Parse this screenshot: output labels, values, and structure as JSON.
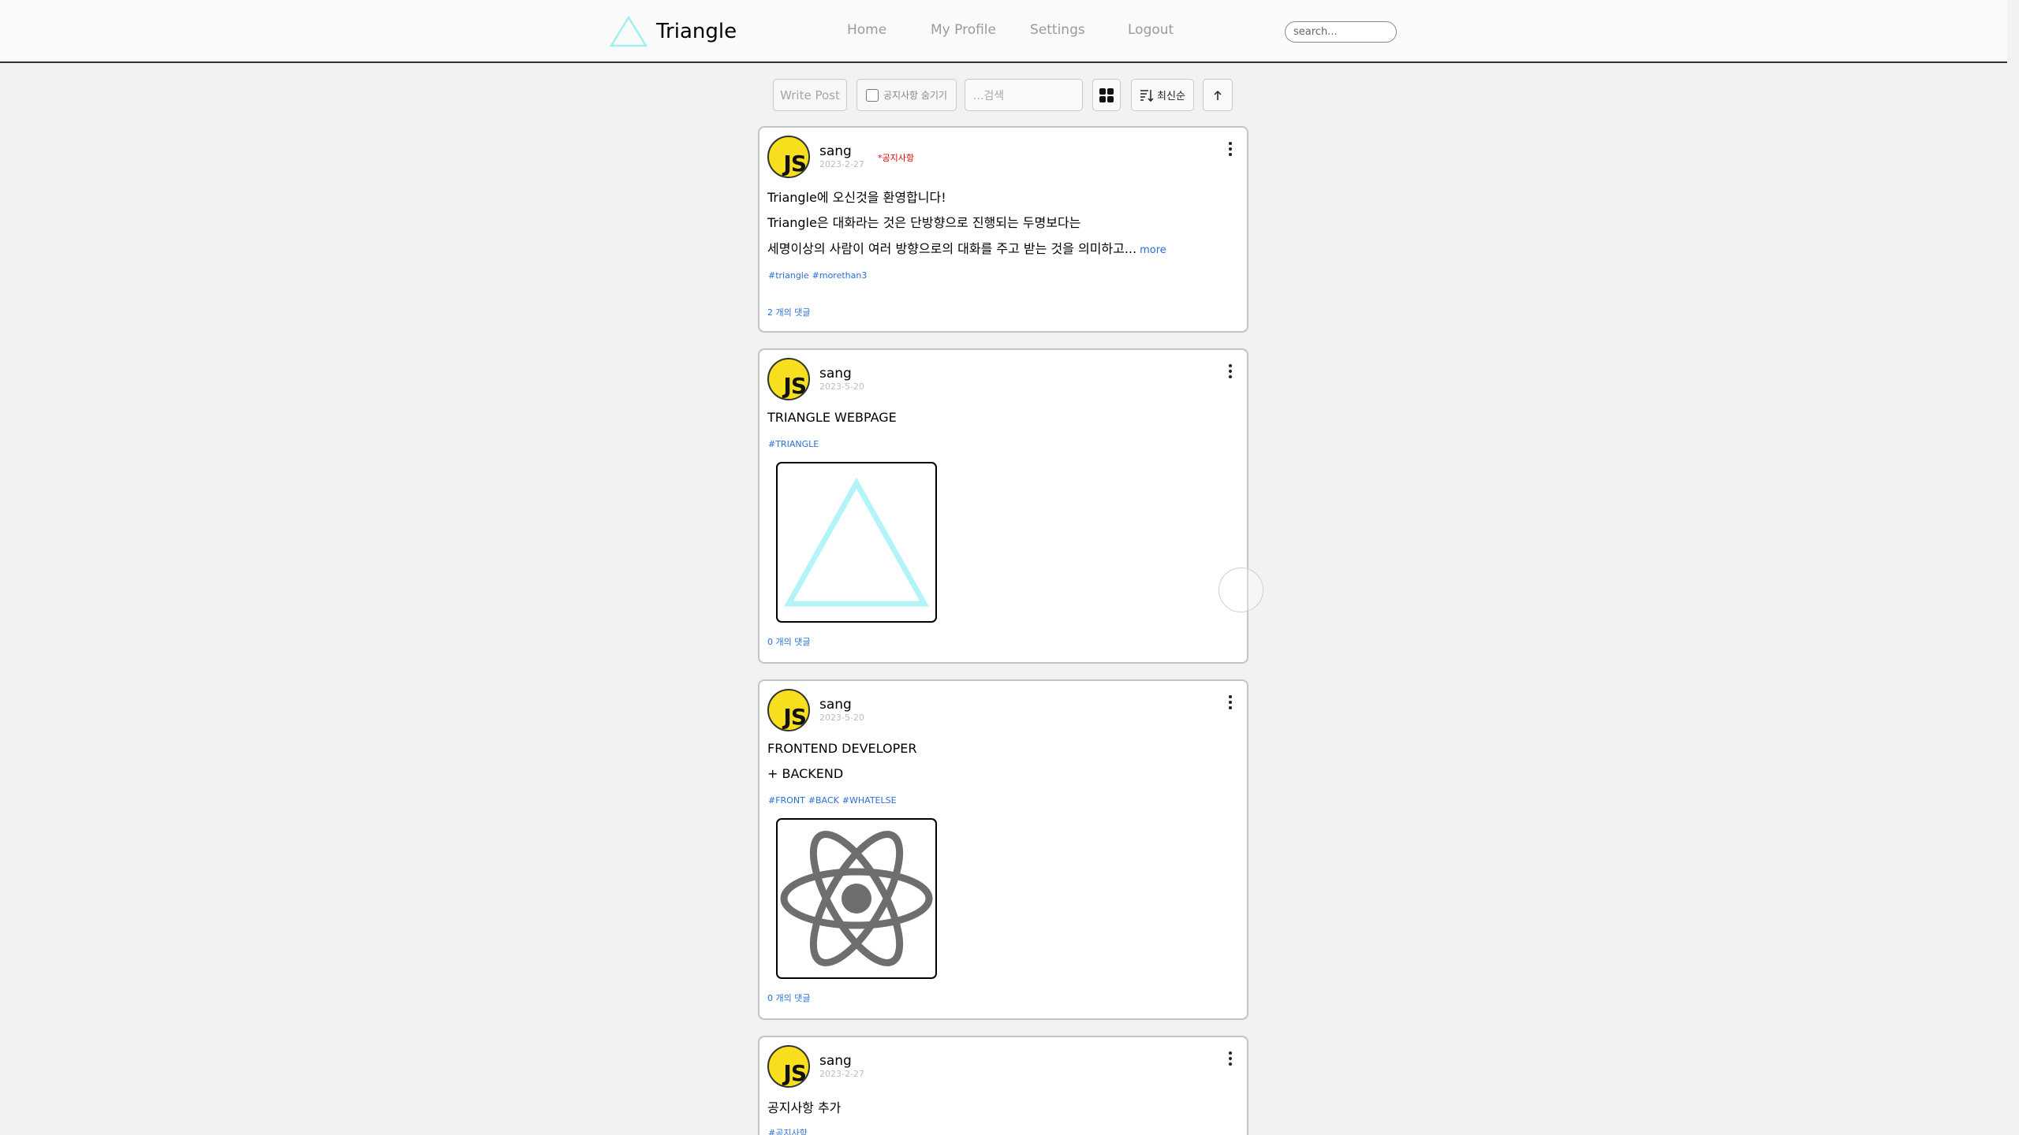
{
  "header": {
    "app_name": "Triangle",
    "nav": [
      "Home",
      "My Profile",
      "Settings",
      "Logout"
    ],
    "search_placeholder": "search..."
  },
  "toolbar": {
    "write_post": "Write Post",
    "hide_notice": "공지사항 숨기기",
    "search_placeholder": "...검색",
    "sort_label": "최신순"
  },
  "posts": [
    {
      "username": "sang",
      "date": "2023-2-27",
      "badge": "*공지사항",
      "lines": [
        "Triangle에 오신것을 환영합니다!",
        "Triangle은 대화라는 것은 단방향으로 진행되는 두명보다는",
        "세명이상의 사람이 여러 방향으로의 대화를 주고 받는 것을 의미하고..."
      ],
      "more": "more",
      "tags": [
        "#triangle",
        "#morethan3"
      ],
      "comments": "2 개의 댓글"
    },
    {
      "username": "sang",
      "date": "2023-5-20",
      "lines": [
        "TRIANGLE WEBPAGE"
      ],
      "tags": [
        "#TRIANGLE"
      ],
      "image": "triangle-logo",
      "comments": "0 개의 댓글"
    },
    {
      "username": "sang",
      "date": "2023-5-20",
      "lines": [
        "FRONTEND DEVELOPER",
        "+ BACKEND"
      ],
      "tags": [
        "#FRONT",
        "#BACK",
        "#WHATELSE"
      ],
      "image": "react-logo",
      "comments": "0 개의 댓글"
    },
    {
      "username": "sang",
      "date": "2023-2-27",
      "lines": [
        "공지사항 추가"
      ],
      "tags": [
        "#공지사항"
      ]
    }
  ],
  "avatar_text": "JS",
  "colors": {
    "accent": "#2a6fd6",
    "logo": "#9ff0f0",
    "avatar": "#f7df1e",
    "notice": "#e00000"
  }
}
